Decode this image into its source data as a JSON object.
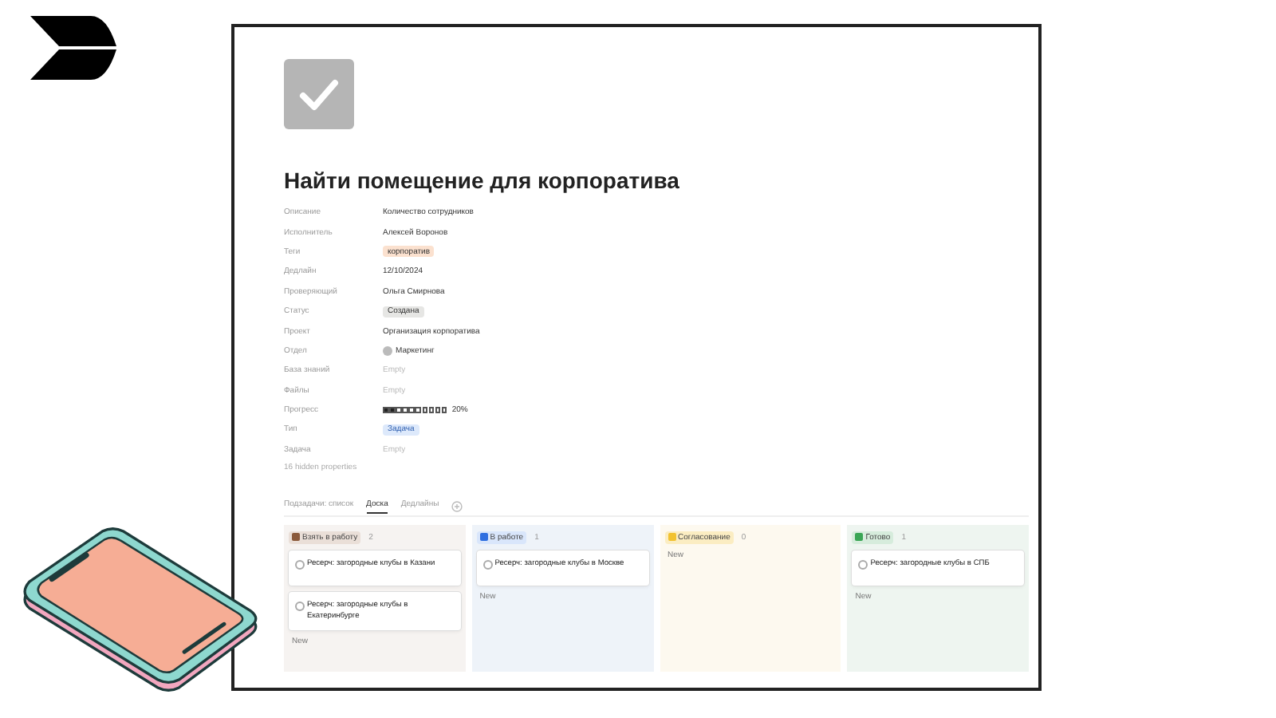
{
  "page": {
    "title": "Найти помещение для корпоратива"
  },
  "properties": [
    {
      "label": "Описание",
      "kind": "text",
      "value": "Количество сотрудников"
    },
    {
      "label": "Исполнитель",
      "kind": "person",
      "value": "Алексей Воронов"
    },
    {
      "label": "Теги",
      "kind": "tag",
      "value": "корпоратив",
      "color": "#fbe1cf"
    },
    {
      "label": "Дедлайн",
      "kind": "text",
      "value": "12/10/2024"
    },
    {
      "label": "Проверяющий",
      "kind": "person",
      "value": "Ольга Смирнова"
    },
    {
      "label": "Статус",
      "kind": "tag",
      "value": "Создана",
      "color": "#e6e6e4"
    },
    {
      "label": "Проект",
      "kind": "page",
      "value": "Организация корпоратива"
    },
    {
      "label": "Отдел",
      "kind": "round",
      "value": "Маркетинг"
    },
    {
      "label": "База знаний",
      "kind": "empty",
      "value": "Empty"
    },
    {
      "label": "Файлы",
      "kind": "empty",
      "value": "Empty"
    },
    {
      "label": "Прогресс",
      "kind": "progress",
      "level": 0.2,
      "value": "20%"
    },
    {
      "label": "Тип",
      "kind": "check-tag",
      "value": "Задача",
      "color": "#dde9fb"
    },
    {
      "label": "Задача",
      "kind": "empty",
      "value": "Empty"
    }
  ],
  "hidden_properties": "16 hidden properties",
  "tabs": [
    {
      "label": "Подзадачи: список",
      "selected": false
    },
    {
      "label": "Доска",
      "selected": true
    },
    {
      "label": "Дедлайны",
      "selected": false
    }
  ],
  "columns": [
    {
      "name": "Взять в работу",
      "count": "2",
      "color": "#8b5a3c",
      "cards": [
        {
          "title": "Ресерч: загородные клубы в Казани",
          "checked": false
        },
        {
          "title": "Ресерч: загородные клубы в Екатеринбурге",
          "checked": false
        }
      ],
      "new": "New"
    },
    {
      "name": "В работе",
      "count": "1",
      "color": "#2f6fe0",
      "cards": [
        {
          "title": "Ресерч: загородные клубы в Москве",
          "checked": false
        }
      ],
      "new": "New"
    },
    {
      "name": "Согласование",
      "count": "0",
      "color": "#f2c230",
      "new": "New"
    },
    {
      "name": "Готово",
      "count": "1",
      "color": "#3aa655",
      "cards": [
        {
          "title": "Ресерч: загородные клубы в СПБ",
          "checked": false
        }
      ],
      "new": "New"
    }
  ]
}
